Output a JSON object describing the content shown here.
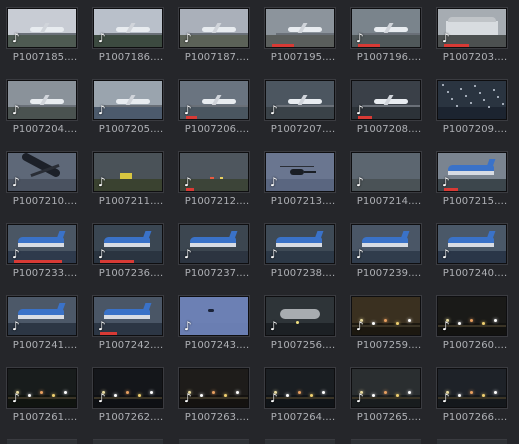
{
  "browser": {
    "clip_icon": "music-note-icon",
    "rows": [
      [
        {
          "label": "P1007185....",
          "sky": "#c8ccd4",
          "ground": "#4e5a52",
          "obj": "plane",
          "note": true,
          "bar": 0,
          "hl": false
        },
        {
          "label": "P1007186....",
          "sky": "#b9c0ca",
          "ground": "#3c4a40",
          "obj": "plane",
          "note": true,
          "bar": 0,
          "hl": false
        },
        {
          "label": "P1007187....",
          "sky": "#aab0ba",
          "ground": "#5c6258",
          "obj": "plane",
          "note": true,
          "bar": 0,
          "hl": false
        },
        {
          "label": "P1007195....",
          "sky": "#8c949c",
          "ground": "#5a5e5c",
          "obj": "plane",
          "note": false,
          "bar": 0.4,
          "hl": false
        },
        {
          "label": "P1007196....",
          "sky": "#7a848c",
          "ground": "#50585a",
          "obj": "plane",
          "note": true,
          "bar": 0.4,
          "hl": false
        },
        {
          "label": "P1007203....",
          "sky": "#a6acb2",
          "ground": "#4c5050",
          "obj": "building",
          "note": true,
          "bar": 0.45,
          "hl": false
        }
      ],
      [
        {
          "label": "P1007204....",
          "sky": "#8a929a",
          "ground": "#4a5250",
          "obj": "plane",
          "note": true,
          "bar": 0,
          "hl": false
        },
        {
          "label": "P1007205....",
          "sky": "#9aa4ae",
          "ground": "#4c5a6c",
          "obj": "plane",
          "note": true,
          "bar": 0,
          "hl": false
        },
        {
          "label": "P1007206....",
          "sky": "#6a7480",
          "ground": "#4a5660",
          "obj": "plane",
          "note": true,
          "bar": 0.2,
          "hl": false
        },
        {
          "label": "P1007207....",
          "sky": "#4c5660",
          "ground": "#3a4248",
          "obj": "plane",
          "note": true,
          "bar": 0,
          "hl": false
        },
        {
          "label": "P1007208....",
          "sky": "#3a4048",
          "ground": "#2c3238",
          "obj": "plane",
          "note": true,
          "bar": 0.25,
          "hl": false
        },
        {
          "label": "P1007209....",
          "sky": "#2a3440",
          "ground": "#1c2430",
          "obj": "rain",
          "note": false,
          "bar": 0,
          "hl": false
        }
      ],
      [
        {
          "label": "P1007210....",
          "sky": "#5e6878",
          "ground": "#4a5260",
          "obj": "bigplane",
          "note": true,
          "bar": 0,
          "hl": false
        },
        {
          "label": "P1007211....",
          "sky": "#4a5258",
          "ground": "#3a4230",
          "obj": "truck",
          "note": true,
          "bar": 0,
          "hl": false
        },
        {
          "label": "P1007212....",
          "sky": "#4e565e",
          "ground": "#3c4438",
          "obj": "lights",
          "note": true,
          "bar": 0.15,
          "hl": false
        },
        {
          "label": "P1007213....",
          "sky": "#6a7690",
          "ground": "#5a6680",
          "obj": "heli",
          "note": true,
          "bar": 0,
          "hl": true
        },
        {
          "label": "P1007214....",
          "sky": "#5c6670",
          "ground": "#4a5256",
          "obj": "none",
          "note": true,
          "bar": 0,
          "hl": false
        },
        {
          "label": "P1007215....",
          "sky": "#7a8490",
          "ground": "#3c464c",
          "obj": "blueplane",
          "note": true,
          "bar": 0.25,
          "hl": false
        }
      ],
      [
        {
          "label": "P1007233....",
          "sky": "#4a5664",
          "ground": "#2e3a4c",
          "obj": "blueplane",
          "note": true,
          "bar": 0.85,
          "hl": false
        },
        {
          "label": "P1007236....",
          "sky": "#3a4652",
          "ground": "#2a3440",
          "obj": "blueplane",
          "note": true,
          "bar": 0.6,
          "hl": false
        },
        {
          "label": "P1007237....",
          "sky": "#3c4650",
          "ground": "#2c3440",
          "obj": "blueplane",
          "note": true,
          "bar": 0,
          "hl": false
        },
        {
          "label": "P1007238....",
          "sky": "#3e4a56",
          "ground": "#2c3846",
          "obj": "blueplane",
          "note": true,
          "bar": 0,
          "hl": false
        },
        {
          "label": "P1007239....",
          "sky": "#4a5666",
          "ground": "#303c4c",
          "obj": "blueplane",
          "note": true,
          "bar": 0,
          "hl": false
        },
        {
          "label": "P1007240....",
          "sky": "#4a5868",
          "ground": "#2a3648",
          "obj": "blueplane",
          "note": true,
          "bar": 0,
          "hl": false
        }
      ],
      [
        {
          "label": "P1007241....",
          "sky": "#4c5868",
          "ground": "#2c3644",
          "obj": "blueplane",
          "note": true,
          "bar": 0,
          "hl": false
        },
        {
          "label": "P1007242....",
          "sky": "#4a5666",
          "ground": "#2c3644",
          "obj": "blueplane",
          "note": true,
          "bar": 0.3,
          "hl": false
        },
        {
          "label": "P1007243....",
          "sky": "#6c80b4",
          "ground": "#6a7eb2",
          "obj": "bird",
          "note": true,
          "bar": 0,
          "hl": true
        },
        {
          "label": "P1007256....",
          "sky": "#2e3438",
          "ground": "#1c2024",
          "obj": "nightplane",
          "note": true,
          "bar": 0,
          "hl": false
        },
        {
          "label": "P1007259....",
          "sky": "#3a3020",
          "ground": "#1c1810",
          "obj": "nightlights",
          "note": true,
          "bar": 0,
          "hl": false
        },
        {
          "label": "P1007260....",
          "sky": "#1a1a18",
          "ground": "#121210",
          "obj": "nightlights",
          "note": true,
          "bar": 0,
          "hl": false
        }
      ],
      [
        {
          "label": "P1007261....",
          "sky": "#181c1c",
          "ground": "#101410",
          "obj": "nightlights",
          "note": true,
          "bar": 0,
          "hl": false
        },
        {
          "label": "P1007262....",
          "sky": "#14161a",
          "ground": "#0e1014",
          "obj": "nightlights",
          "note": true,
          "bar": 0,
          "hl": false
        },
        {
          "label": "P1007263....",
          "sky": "#1e1c1a",
          "ground": "#141210",
          "obj": "nightlights",
          "note": true,
          "bar": 0,
          "hl": false
        },
        {
          "label": "P1007264....",
          "sky": "#1a1e22",
          "ground": "#101418",
          "obj": "nightlights",
          "note": true,
          "bar": 0,
          "hl": false
        },
        {
          "label": "P1007265....",
          "sky": "#2a2e30",
          "ground": "#181c1e",
          "obj": "nightlights",
          "note": true,
          "bar": 0,
          "hl": false
        },
        {
          "label": "P1007266....",
          "sky": "#1e2228",
          "ground": "#14181c",
          "obj": "nightlights",
          "note": true,
          "bar": 0,
          "hl": false
        }
      ]
    ]
  }
}
